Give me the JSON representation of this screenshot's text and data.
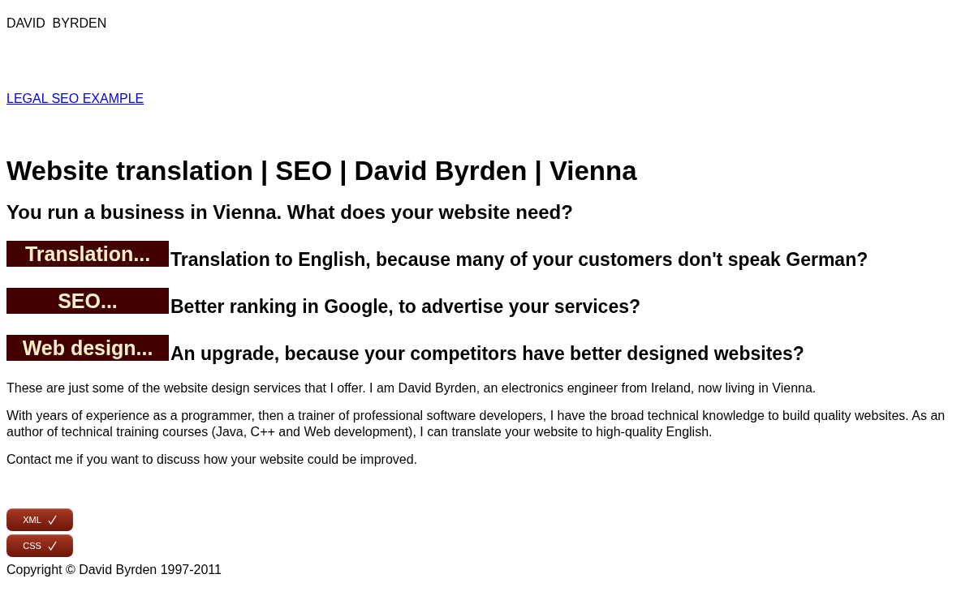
{
  "site_name": "DAVID  BYRDEN",
  "link": "LEGAL SEO EXAMPLE",
  "title": "Website translation | SEO | David Byrden | Vienna",
  "subtitle": "You run a business in Vienna. What does your website need?",
  "services": [
    {
      "badge": "Translation...",
      "text": "Translation to English, because many of your customers don't speak German?"
    },
    {
      "badge": "SEO...",
      "text": "Better ranking in Google, to advertise your services?"
    },
    {
      "badge": "Web design...",
      "text": "An upgrade, because your competitors have better designed websites?"
    }
  ],
  "paragraphs": [
    "These are just some of the website design services that I offer. I am David Byrden, an electronics engineer from Ireland, now living in Vienna.",
    "With years of experience as a programmer, then a trainer of professional software developers, I have the broad technical knowledge to build quality websites. As an author of technical training courses (Java, C++ and Web development), I can translate your website to high-quality English.",
    "Contact me if you want to discuss how your website could be improved."
  ],
  "validators": [
    "XML",
    "CSS"
  ],
  "copyright": "Copyright © David Byrden 1997-2011"
}
